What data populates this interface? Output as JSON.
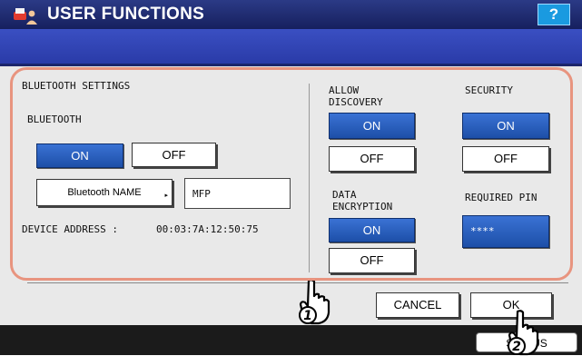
{
  "title": "USER FUNCTIONS",
  "help_label": "?",
  "section_title": "BLUETOOTH SETTINGS",
  "bluetooth": {
    "label": "BLUETOOTH",
    "on": "ON",
    "off": "OFF",
    "name_button": "Bluetooth NAME",
    "name_arrow": "▸",
    "name_value": "MFP",
    "device_address_label": "DEVICE ADDRESS :",
    "device_address_value": "00:03:7A:12:50:75"
  },
  "allow_discovery": {
    "label": "ALLOW\nDISCOVERY",
    "on": "ON",
    "off": "OFF"
  },
  "security": {
    "label": "SECURITY",
    "on": "ON",
    "off": "OFF"
  },
  "data_encryption": {
    "label": "DATA\nENCRYPTION",
    "on": "ON",
    "off": "OFF"
  },
  "required_pin": {
    "label": "REQUIRED PIN",
    "value": "****"
  },
  "footer": {
    "cancel": "CANCEL",
    "ok": "OK",
    "status": "STATUS"
  },
  "callouts": {
    "one": "1",
    "two": "2"
  }
}
